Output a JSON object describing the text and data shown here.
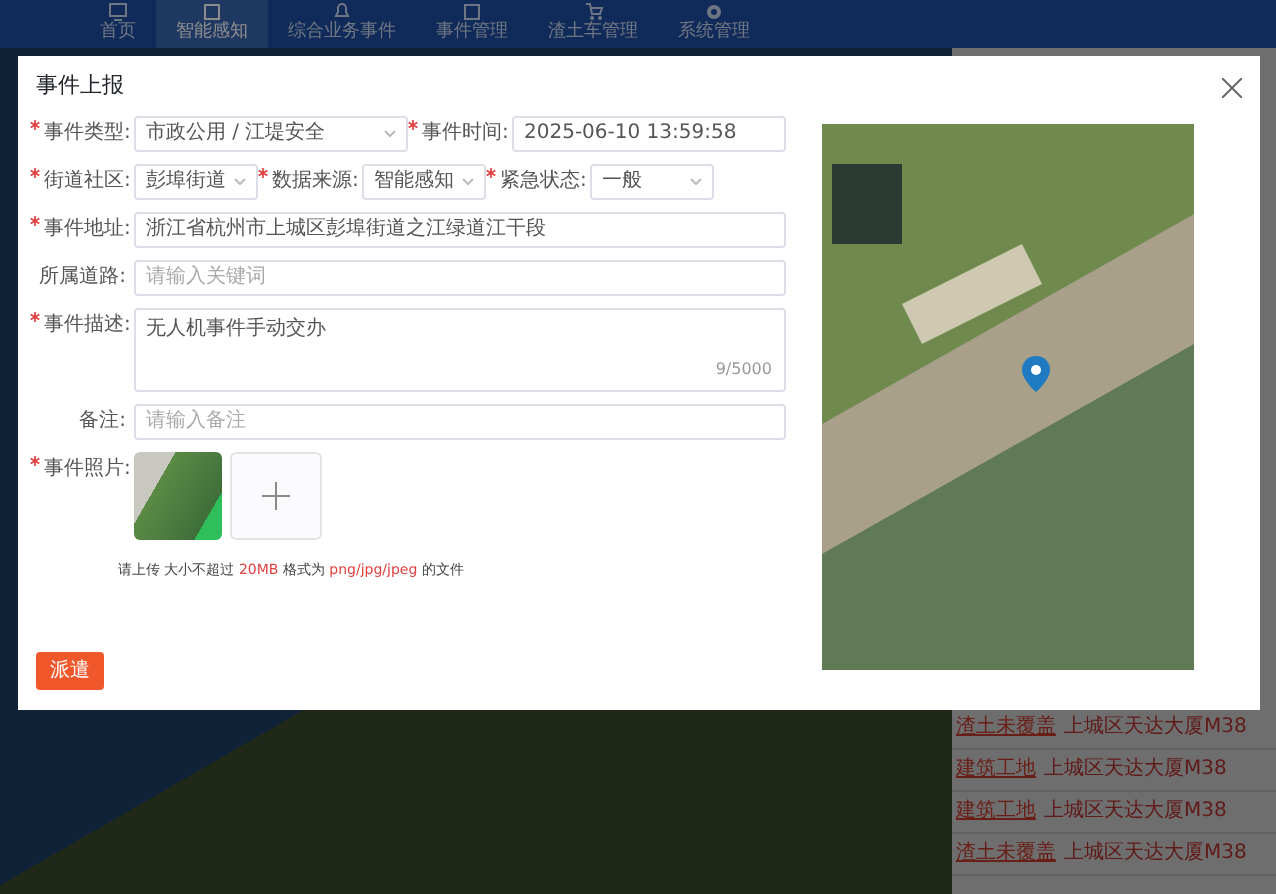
{
  "nav": {
    "items": [
      {
        "label": "首页",
        "selected": false
      },
      {
        "label": "智能感知",
        "selected": true
      },
      {
        "label": "综合业务事件",
        "selected": false
      },
      {
        "label": "事件管理",
        "selected": false
      },
      {
        "label": "渣土车管理",
        "selected": false
      },
      {
        "label": "系统管理",
        "selected": false
      }
    ]
  },
  "background_table": {
    "rows": [
      {
        "type": "渣土未覆盖",
        "address": "上城区天达大厦M38"
      },
      {
        "type": "建筑工地",
        "address": "上城区天达大厦M38"
      },
      {
        "type": "建筑工地",
        "address": "上城区天达大厦M38"
      },
      {
        "type": "渣土未覆盖",
        "address": "上城区天达大厦M38"
      }
    ]
  },
  "dialog": {
    "title": "事件上报",
    "fields": [
      {
        "kind": "select",
        "label": "事件类型:",
        "required": true,
        "value": "市政公用 / 江堤安全"
      },
      {
        "kind": "date",
        "label": "事件时间:",
        "required": true,
        "value": "2025-06-10 13:59:58"
      },
      {
        "kind": "select",
        "label": "街道社区:",
        "required": true,
        "value": "彭埠街道"
      },
      {
        "kind": "select",
        "label": "数据来源:",
        "required": true,
        "value": "智能感知"
      },
      {
        "kind": "select",
        "label": "紧急状态:",
        "required": true,
        "value": "一般"
      },
      {
        "kind": "text",
        "label": "事件地址:",
        "required": true,
        "value": "浙江省杭州市上城区彭埠街道之江绿道江干段"
      },
      {
        "kind": "text",
        "label": "所属道路:",
        "required": false,
        "placeholder": "请输入关键词"
      },
      {
        "kind": "textarea",
        "label": "事件描述:",
        "required": true,
        "value": "无人机事件手动交办",
        "counter": "9/5000"
      },
      {
        "kind": "text",
        "label": "备注:",
        "required": false,
        "placeholder": "请输入备注"
      },
      {
        "kind": "upload",
        "label": "事件照片:",
        "required": true
      }
    ],
    "upload_hint": "请上传 大小不超过 **20MB** 格式为 **png/jpg/jpeg** 的文件",
    "submit_button": "派遣"
  }
}
